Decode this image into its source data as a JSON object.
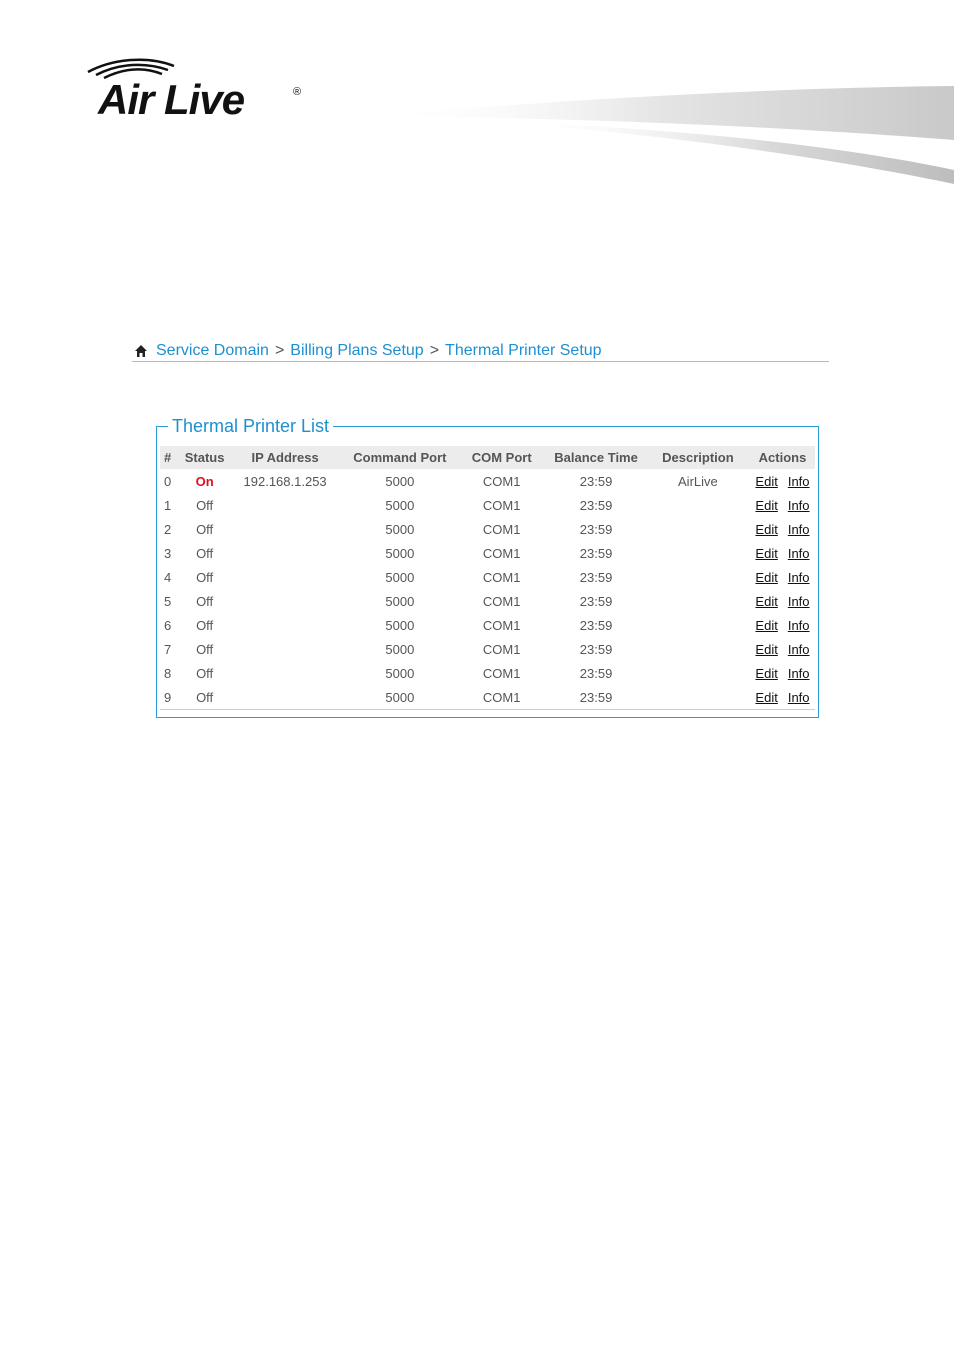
{
  "brand": {
    "logo_text": "Air Live",
    "registered_mark": "®"
  },
  "breadcrumb": {
    "items": [
      "Service Domain",
      "Billing Plans Setup",
      "Thermal Printer Setup"
    ],
    "separator": ">"
  },
  "panel": {
    "legend": "Thermal Printer List"
  },
  "table": {
    "headers": [
      "#",
      "Status",
      "IP Address",
      "Command Port",
      "COM Port",
      "Balance Time",
      "Description",
      "Actions"
    ],
    "rows": [
      {
        "num": "0",
        "status": "On",
        "ip": "192.168.1.253",
        "cmd_port": "5000",
        "com_port": "COM1",
        "balance": "23:59",
        "desc": "AirLive",
        "edit": "Edit",
        "info": "Info"
      },
      {
        "num": "1",
        "status": "Off",
        "ip": "",
        "cmd_port": "5000",
        "com_port": "COM1",
        "balance": "23:59",
        "desc": "",
        "edit": "Edit",
        "info": "Info"
      },
      {
        "num": "2",
        "status": "Off",
        "ip": "",
        "cmd_port": "5000",
        "com_port": "COM1",
        "balance": "23:59",
        "desc": "",
        "edit": "Edit",
        "info": "Info"
      },
      {
        "num": "3",
        "status": "Off",
        "ip": "",
        "cmd_port": "5000",
        "com_port": "COM1",
        "balance": "23:59",
        "desc": "",
        "edit": "Edit",
        "info": "Info"
      },
      {
        "num": "4",
        "status": "Off",
        "ip": "",
        "cmd_port": "5000",
        "com_port": "COM1",
        "balance": "23:59",
        "desc": "",
        "edit": "Edit",
        "info": "Info"
      },
      {
        "num": "5",
        "status": "Off",
        "ip": "",
        "cmd_port": "5000",
        "com_port": "COM1",
        "balance": "23:59",
        "desc": "",
        "edit": "Edit",
        "info": "Info"
      },
      {
        "num": "6",
        "status": "Off",
        "ip": "",
        "cmd_port": "5000",
        "com_port": "COM1",
        "balance": "23:59",
        "desc": "",
        "edit": "Edit",
        "info": "Info"
      },
      {
        "num": "7",
        "status": "Off",
        "ip": "",
        "cmd_port": "5000",
        "com_port": "COM1",
        "balance": "23:59",
        "desc": "",
        "edit": "Edit",
        "info": "Info"
      },
      {
        "num": "8",
        "status": "Off",
        "ip": "",
        "cmd_port": "5000",
        "com_port": "COM1",
        "balance": "23:59",
        "desc": "",
        "edit": "Edit",
        "info": "Info"
      },
      {
        "num": "9",
        "status": "Off",
        "ip": "",
        "cmd_port": "5000",
        "com_port": "COM1",
        "balance": "23:59",
        "desc": "",
        "edit": "Edit",
        "info": "Info"
      }
    ]
  },
  "colors": {
    "accent": "#1e8fd0",
    "status_on": "#e0111b",
    "header_bg": "#ececec"
  },
  "icons": {
    "home": "home-icon"
  }
}
